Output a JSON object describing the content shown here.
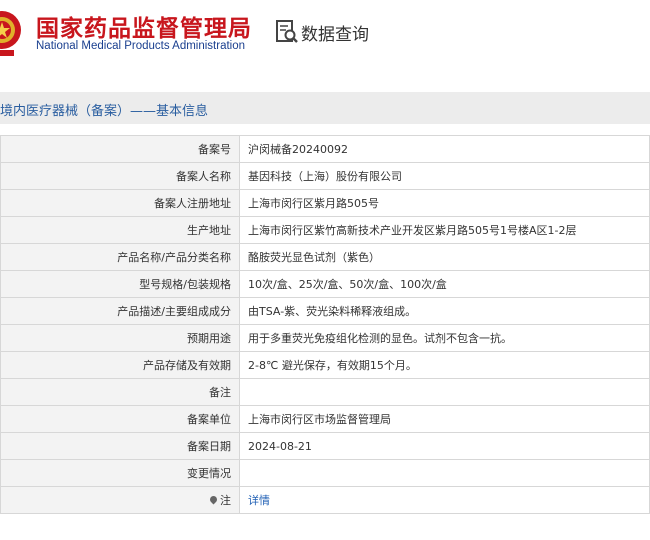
{
  "header": {
    "org_name_cn": "国家药品监督管理局",
    "org_name_en": "National Medical Products Administration",
    "search_label": "数据查询"
  },
  "section": {
    "title": "境内医疗器械（备案）——基本信息"
  },
  "rows": [
    {
      "label": "备案号",
      "value": "沪闵械备20240092"
    },
    {
      "label": "备案人名称",
      "value": "基因科技（上海）股份有限公司"
    },
    {
      "label": "备案人注册地址",
      "value": "上海市闵行区紫月路505号"
    },
    {
      "label": "生产地址",
      "value": "上海市闵行区紫竹高新技术产业开发区紫月路505号1号楼A区1-2层"
    },
    {
      "label": "产品名称/产品分类名称",
      "value": "酪胺荧光显色试剂（紫色）"
    },
    {
      "label": "型号规格/包装规格",
      "value": "10次/盒、25次/盒、50次/盒、100次/盒"
    },
    {
      "label": "产品描述/主要组成成分",
      "value": "由TSA-紫、荧光染料稀释液组成。"
    },
    {
      "label": "预期用途",
      "value": "用于多重荧光免疫组化检测的显色。试剂不包含一抗。"
    },
    {
      "label": "产品存储及有效期",
      "value": "2-8℃ 避光保存，有效期15个月。"
    },
    {
      "label": "备注",
      "value": ""
    },
    {
      "label": "备案单位",
      "value": "上海市闵行区市场监督管理局"
    },
    {
      "label": "备案日期",
      "value": "2024-08-21"
    },
    {
      "label": "变更情况",
      "value": ""
    }
  ],
  "note_row": {
    "label": "注",
    "link": "详情"
  }
}
